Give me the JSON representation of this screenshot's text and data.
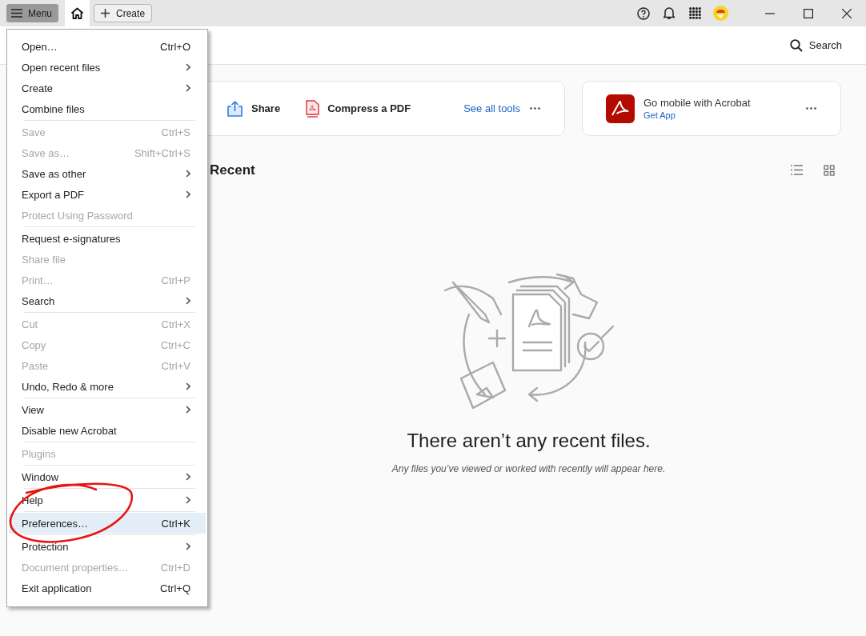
{
  "titlebar": {
    "menu_button": "Menu",
    "create_button": "Create"
  },
  "header": {
    "search": "Search"
  },
  "tools_card": {
    "tools": [
      {
        "kind": "share",
        "label": "Share"
      },
      {
        "kind": "compress",
        "label": "Compress a PDF"
      }
    ],
    "see_all": "See all tools"
  },
  "promo_card": {
    "title": "Go mobile with Acrobat",
    "link": "Get App"
  },
  "recent": {
    "heading": "Recent",
    "empty_title": "There aren’t any recent files.",
    "empty_hint": "Any files you’ve viewed or worked with recently will appear here."
  },
  "menu": {
    "groups": [
      [
        {
          "label": "Open…",
          "shortcut": "Ctrl+O",
          "submenu": false,
          "disabled": false,
          "selected": false
        },
        {
          "label": "Open recent files",
          "submenu": true,
          "disabled": false,
          "selected": false
        },
        {
          "label": "Create",
          "submenu": true,
          "disabled": false,
          "selected": false
        },
        {
          "label": "Combine files",
          "submenu": false,
          "disabled": false,
          "selected": false
        }
      ],
      [
        {
          "label": "Save",
          "shortcut": "Ctrl+S",
          "submenu": false,
          "disabled": true,
          "selected": false
        },
        {
          "label": "Save as…",
          "shortcut": "Shift+Ctrl+S",
          "submenu": false,
          "disabled": true,
          "selected": false
        },
        {
          "label": "Save as other",
          "submenu": true,
          "disabled": false,
          "selected": false
        },
        {
          "label": "Export a PDF",
          "submenu": true,
          "disabled": false,
          "selected": false
        },
        {
          "label": "Protect Using Password",
          "submenu": false,
          "disabled": true,
          "selected": false
        }
      ],
      [
        {
          "label": "Request e-signatures",
          "submenu": false,
          "disabled": false,
          "selected": false
        },
        {
          "label": "Share file",
          "submenu": false,
          "disabled": true,
          "selected": false
        },
        {
          "label": "Print…",
          "shortcut": "Ctrl+P",
          "submenu": false,
          "disabled": true,
          "selected": false
        },
        {
          "label": "Search",
          "submenu": true,
          "disabled": false,
          "selected": false
        }
      ],
      [
        {
          "label": "Cut",
          "shortcut": "Ctrl+X",
          "submenu": false,
          "disabled": true,
          "selected": false
        },
        {
          "label": "Copy",
          "shortcut": "Ctrl+C",
          "submenu": false,
          "disabled": true,
          "selected": false
        },
        {
          "label": "Paste",
          "shortcut": "Ctrl+V",
          "submenu": false,
          "disabled": true,
          "selected": false
        },
        {
          "label": "Undo, Redo & more",
          "submenu": true,
          "disabled": false,
          "selected": false
        }
      ],
      [
        {
          "label": "View",
          "submenu": true,
          "disabled": false,
          "selected": false
        },
        {
          "label": "Disable new Acrobat",
          "submenu": false,
          "disabled": false,
          "selected": false
        }
      ],
      [
        {
          "label": "Plugins",
          "submenu": false,
          "disabled": true,
          "selected": false
        }
      ],
      [
        {
          "label": "Window",
          "submenu": true,
          "disabled": false,
          "selected": false
        }
      ],
      [
        {
          "label": "Help",
          "submenu": true,
          "disabled": false,
          "selected": false
        }
      ],
      [
        {
          "label": "Preferences…",
          "shortcut": "Ctrl+K",
          "submenu": false,
          "disabled": false,
          "selected": true
        }
      ],
      [
        {
          "label": "Protection",
          "submenu": true,
          "disabled": false,
          "selected": false
        },
        {
          "label": "Document properties…",
          "shortcut": "Ctrl+D",
          "submenu": false,
          "disabled": true,
          "selected": false
        },
        {
          "label": "Exit application",
          "shortcut": "Ctrl+Q",
          "submenu": false,
          "disabled": false,
          "selected": false
        }
      ]
    ]
  }
}
